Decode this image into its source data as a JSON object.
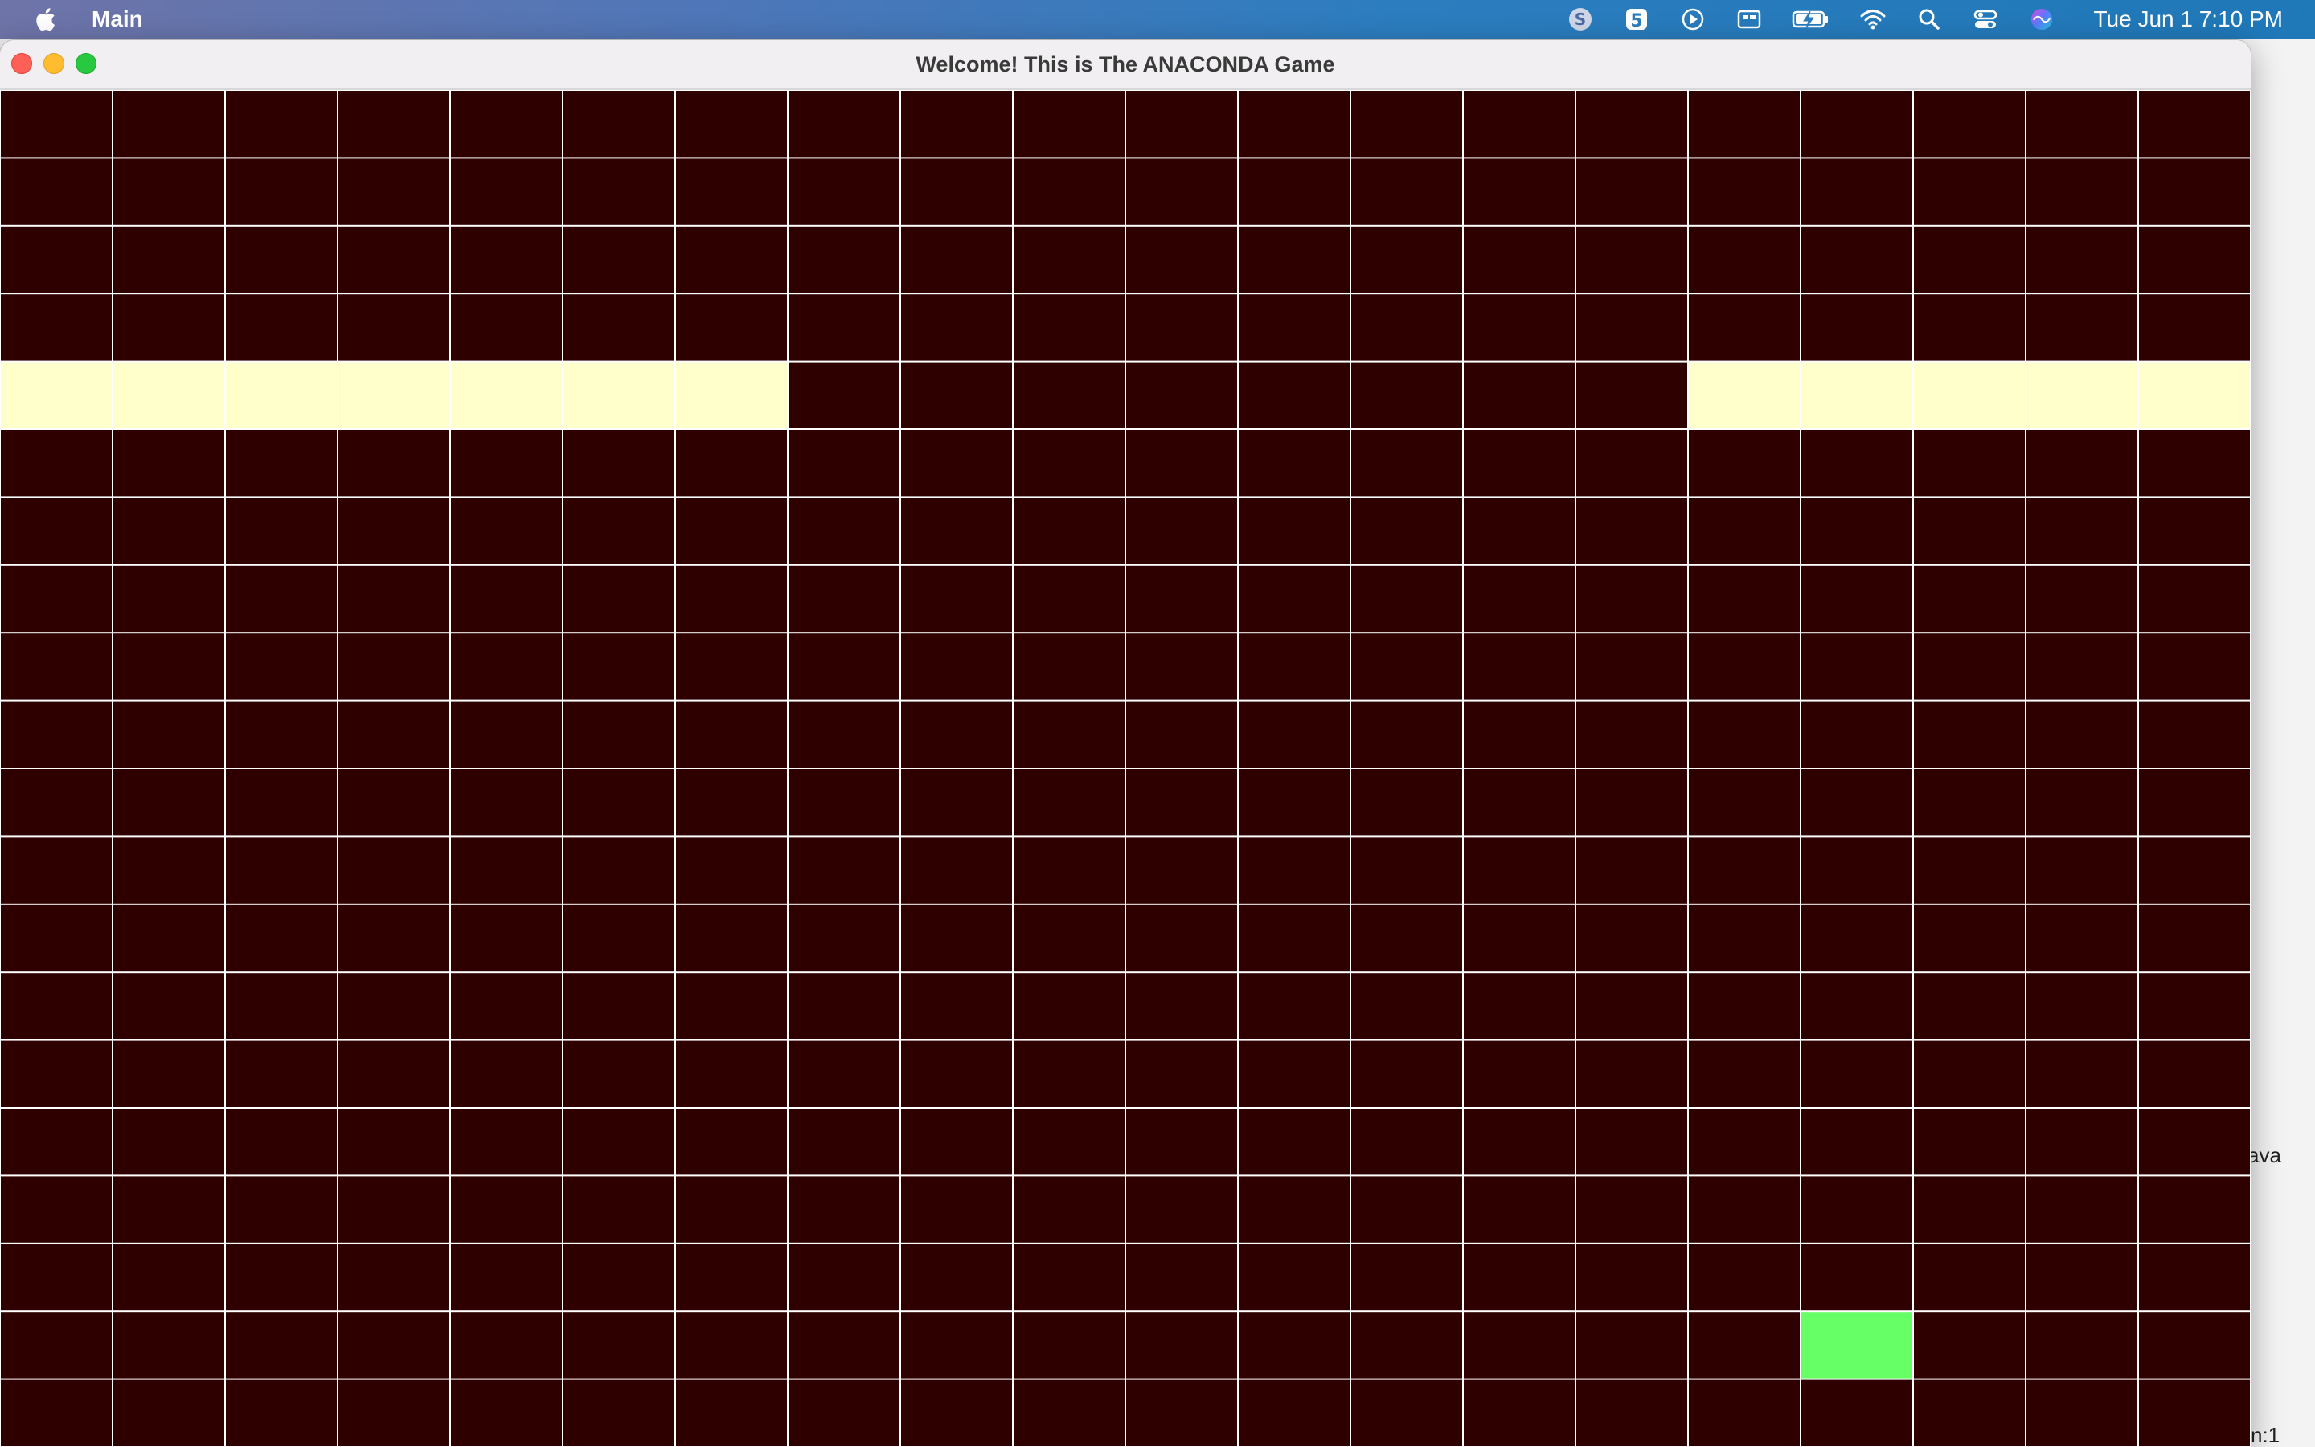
{
  "menubar": {
    "app_name": "Main",
    "clock": "Tue Jun 1  7:10 PM",
    "status_icons": [
      "skype-icon",
      "s-icon",
      "play-icon",
      "display-icon",
      "battery-charging-icon",
      "wifi-icon",
      "search-icon",
      "control-center-icon",
      "siri-icon"
    ]
  },
  "window": {
    "title": "Welcome! This is The ANACONDA Game"
  },
  "background_window": {
    "button_fragment": "ava",
    "bottom_fragment": "n:1"
  },
  "game": {
    "columns": 20,
    "rows": 20,
    "colors": {
      "empty": "#2e0000",
      "grid_line": "#d8d8d8",
      "snake": "#ffffcc",
      "food": "#66ff66"
    },
    "snake_cells": [
      [
        0,
        4
      ],
      [
        1,
        4
      ],
      [
        2,
        4
      ],
      [
        3,
        4
      ],
      [
        4,
        4
      ],
      [
        5,
        4
      ],
      [
        6,
        4
      ],
      [
        15,
        4
      ],
      [
        16,
        4
      ],
      [
        17,
        4
      ],
      [
        18,
        4
      ],
      [
        19,
        4
      ]
    ],
    "food_cell": [
      16,
      18
    ]
  }
}
